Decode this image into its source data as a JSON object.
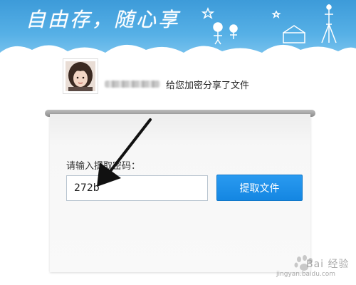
{
  "header": {
    "slogan": "自由存，随心享"
  },
  "share": {
    "username_blurred": true,
    "message": "给您加密分享了文件"
  },
  "form": {
    "label": "请输入提取密码：",
    "code_value": "272b",
    "submit_label": "提取文件"
  },
  "watermark": {
    "brand": "Bai 经验",
    "sub": "jingyan.baidu.com"
  },
  "colors": {
    "banner": "#4aa6e0",
    "button": "#1a8ce8",
    "arrow": "#111111"
  }
}
